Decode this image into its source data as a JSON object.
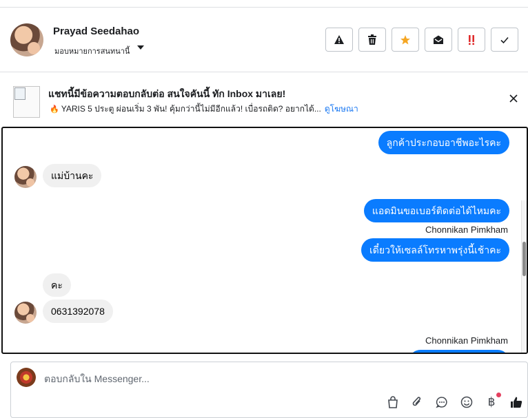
{
  "conversation": {
    "name": "Prayad Seedahao",
    "assign_label": "มอบหมายการสนทนานี้"
  },
  "actions": [
    {
      "name": "report-spam",
      "icon": "warning-icon"
    },
    {
      "name": "delete",
      "icon": "trash-icon"
    },
    {
      "name": "star",
      "icon": "star-icon",
      "color": "#f5a623"
    },
    {
      "name": "mark-unread",
      "icon": "envelope-open-icon"
    },
    {
      "name": "follow-up",
      "icon": "double-exclamation-icon",
      "color": "#e02d2d"
    },
    {
      "name": "mark-done",
      "icon": "checkmark-icon"
    }
  ],
  "ad": {
    "title": "แชทนี้มีข้อความตอบกลับต่อ สนใจคันนี้ ทัก Inbox มาเลย!",
    "text": "YARIS 5 ประตู ผ่อนเริ่ม 3 พัน! คุ้มกว่านี้ไม่มีอีกแล้ว! เบื่อรถติด? อยากได้...",
    "link": "ดูโฆษณา"
  },
  "messages": {
    "m1": "ลูกค้าประกอบอาชีพอะไรคะ",
    "m2": "แม่บ้านคะ",
    "m3": "แอดมินขอเบอร์ติดต่อได้ไหมคะ",
    "sender1": "Chonnikan Pimkham",
    "m4": "เดี๋ยวให้เซลล์โทรหาพรุ่งนี้เช้าคะ",
    "m5": "คะ",
    "m6": "0631392078",
    "sender2": "Chonnikan Pimkham"
  },
  "composer": {
    "placeholder": "ตอบกลับใน Messenger...",
    "tools": [
      "shopping-bag-icon",
      "paperclip-icon",
      "saved-reply-icon",
      "emoji-icon",
      "baht-payment-icon",
      "thumbs-up-icon"
    ]
  },
  "colors": {
    "outgoing_bubble": "#0a7cff",
    "incoming_bubble": "#f0f0f0",
    "link": "#1877f2"
  }
}
